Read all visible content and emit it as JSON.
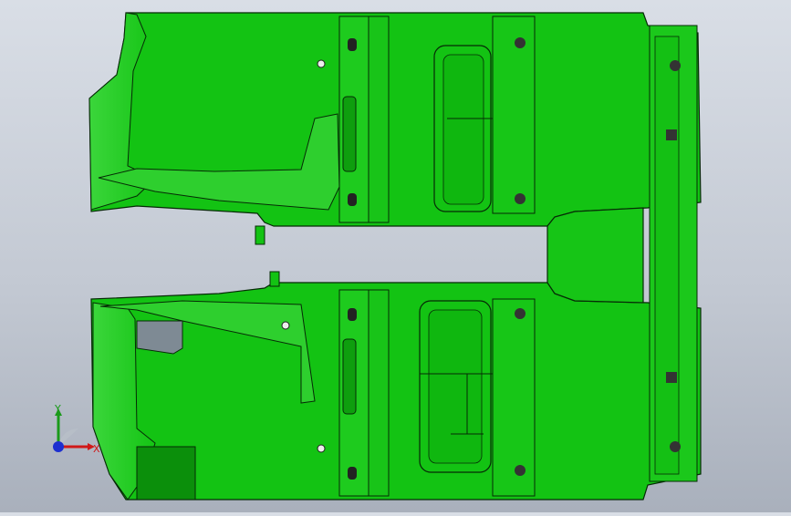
{
  "window": {
    "title": ""
  },
  "viewport": {
    "background": [
      "#d9dee6",
      "#a9b0bc"
    ],
    "part_fill": "#13c313",
    "part_fill_light": "#45d445",
    "part_fill_dark": "#0a9a0a",
    "edge_color": "#0a2a0a"
  },
  "triad": {
    "x_label": "X",
    "y_label": "Y",
    "x_color": "#d01818",
    "y_color": "#1a9a1a",
    "z_color": "#1c2fd0"
  }
}
